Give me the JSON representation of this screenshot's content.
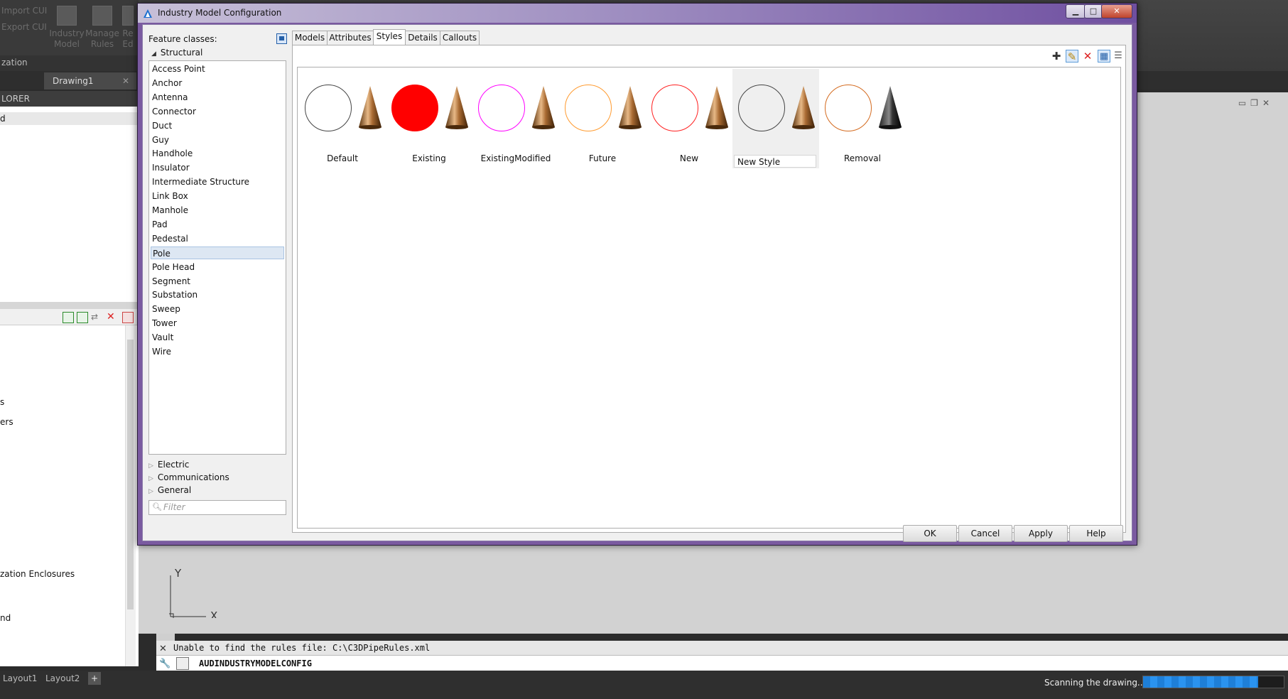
{
  "background_app": {
    "ribbon_links": [
      "Import CUI",
      "Export CUI"
    ],
    "ribbon_tools": [
      {
        "label": "Industry Model"
      },
      {
        "label": "Manage Rules"
      },
      {
        "label": "Re Ed"
      }
    ],
    "panel_title": "zation",
    "drawing_tab": "Drawing1",
    "explorer_header": "LORER",
    "left_top_row": "d",
    "left_list": [
      "s",
      "ers",
      "zation Enclosures",
      "nd"
    ],
    "command_output": "Unable to find the rules file: C:\\C3DPipeRules.xml",
    "command_input": "AUDINDUSTRYMODELCONFIG",
    "layout_tabs": [
      "Layout1",
      "Layout2",
      "+"
    ],
    "status_text": "Scanning the drawing...",
    "scan_progress": 0.82,
    "ucs_axes": {
      "x": "X",
      "y": "Y"
    }
  },
  "dialog": {
    "title": "Industry Model Configuration",
    "feature_classes_label": "Feature classes:",
    "tree_group": "Structural",
    "feature_classes": [
      "Access Point",
      "Anchor",
      "Antenna",
      "Connector",
      "Duct",
      "Guy",
      "Handhole",
      "Insulator",
      "Intermediate Structure",
      "Link Box",
      "Manhole",
      "Pad",
      "Pedestal",
      "Pole",
      "Pole Head",
      "Segment",
      "Substation",
      "Sweep",
      "Tower",
      "Vault",
      "Wire"
    ],
    "selected_feature_class": "Pole",
    "other_groups": [
      "Electric",
      "Communications",
      "General"
    ],
    "filter_placeholder": "Filter",
    "tabs": [
      "Models",
      "Attributes",
      "Styles",
      "Details",
      "Callouts"
    ],
    "active_tab": "Styles",
    "styles": [
      {
        "name": "Default",
        "circle_color": "#444444",
        "filled": false,
        "cone": "bronze"
      },
      {
        "name": "Existing",
        "circle_color": "#ff0000",
        "filled": true,
        "cone": "bronze"
      },
      {
        "name": "ExistingModified",
        "circle_color": "#ff00ff",
        "filled": false,
        "cone": "bronze"
      },
      {
        "name": "Future",
        "circle_color": "#ff9a2e",
        "filled": false,
        "cone": "bronze"
      },
      {
        "name": "New",
        "circle_color": "#ff2020",
        "filled": false,
        "cone": "bronze"
      },
      {
        "name": "New Style",
        "circle_color": "#444444",
        "filled": false,
        "cone": "bronze",
        "editing": true
      },
      {
        "name": "Removal",
        "circle_color": "#d46a1e",
        "filled": false,
        "cone": "black"
      }
    ],
    "style_toolbar": [
      "add-icon",
      "edit-icon",
      "delete-icon",
      "grid-view-icon",
      "list-view-icon"
    ],
    "buttons": {
      "ok": "OK",
      "cancel": "Cancel",
      "apply": "Apply",
      "help": "Help"
    }
  }
}
